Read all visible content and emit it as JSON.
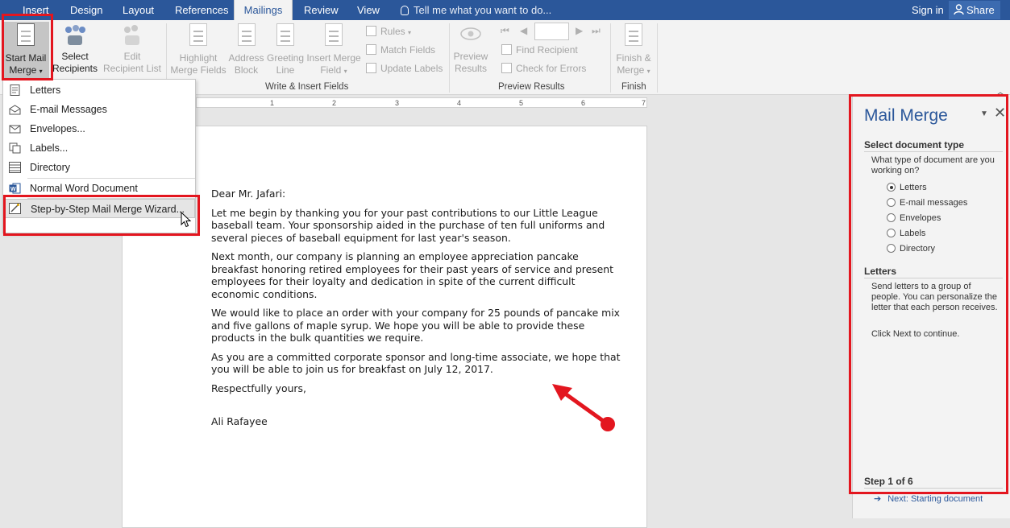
{
  "tabs": {
    "insert": "Insert",
    "design": "Design",
    "layout": "Layout",
    "references": "References",
    "mailings": "Mailings",
    "review": "Review",
    "view": "View"
  },
  "tell_me": "Tell me what you want to do...",
  "sign_in": "Sign in",
  "share": "Share",
  "ribbon": {
    "start_mail_merge": [
      "Start Mail",
      "Merge"
    ],
    "select_recipients": [
      "Select",
      "Recipients"
    ],
    "edit_recipient_list": [
      "Edit",
      "Recipient List"
    ],
    "highlight_merge_fields": [
      "Highlight",
      "Merge Fields"
    ],
    "address_block": [
      "Address",
      "Block"
    ],
    "greeting_line": [
      "Greeting",
      "Line"
    ],
    "insert_merge_field": [
      "Insert Merge",
      "Field"
    ],
    "rules": "Rules",
    "match_fields": "Match Fields",
    "update_labels": "Update Labels",
    "preview_results": [
      "Preview",
      "Results"
    ],
    "find_recipient": "Find Recipient",
    "check_for_errors": "Check for Errors",
    "finish_merge": [
      "Finish &",
      "Merge"
    ],
    "groups": {
      "write_insert": "Write & Insert Fields",
      "preview": "Preview Results",
      "finish": "Finish"
    }
  },
  "ruler_marks": [
    "1",
    "2",
    "3",
    "4",
    "5",
    "6",
    "7"
  ],
  "menu": {
    "items": [
      {
        "label": "Letters",
        "icon": "letters-icon"
      },
      {
        "label": "E-mail Messages",
        "icon": "email-icon"
      },
      {
        "label": "Envelopes...",
        "icon": "envelope-icon"
      },
      {
        "label": "Labels...",
        "icon": "labels-icon"
      },
      {
        "label": "Directory",
        "icon": "directory-icon"
      },
      {
        "label": "Normal Word Document",
        "icon": "word-icon"
      },
      {
        "label": "Step-by-Step Mail Merge Wizard...",
        "icon": "wizard-icon"
      }
    ]
  },
  "letter": {
    "greeting": "Dear Mr. Jafari:",
    "paragraphs": [
      "Let me begin by thanking you for your past contributions to our Little League baseball team. Your sponsorship aided in the purchase of ten full uniforms and several pieces of baseball equipment for last year's season.",
      "Next month, our company is planning an employee appreciation pancake breakfast honoring retired employees for their past years of service and present employees for their loyalty and dedication in spite of the current difficult economic conditions.",
      "We would like to place an order with your company for 25 pounds of pancake mix and five gallons of maple syrup. We hope you will be able to provide these products in the bulk quantities we require.",
      "As you are a committed corporate sponsor and long-time associate, we hope that you will be able to join us for breakfast on July 12, 2017."
    ],
    "closing": "Respectfully yours,",
    "signature": "Ali Rafayee"
  },
  "pane": {
    "title": "Mail Merge",
    "section_heading": "Select document type",
    "question": "What type of document are you working on?",
    "options": [
      "Letters",
      "E-mail messages",
      "Envelopes",
      "Labels",
      "Directory"
    ],
    "selected_option": "Letters",
    "info_heading": "Letters",
    "info_text": "Send letters to a group of people. You can personalize the letter that each person receives.",
    "instruction": "Click Next to continue.",
    "step": "Step 1 of 6",
    "next_link": "Next: Starting document"
  },
  "colors": {
    "accent": "#2b579a",
    "highlight_red": "#e3161f"
  }
}
